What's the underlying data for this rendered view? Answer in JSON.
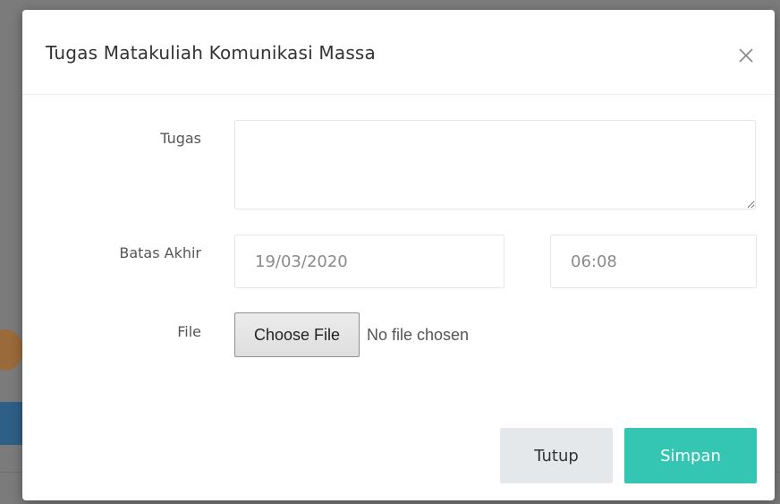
{
  "modal": {
    "title": "Tugas Matakuliah Komunikasi Massa",
    "close_icon": "close-icon",
    "fields": {
      "tugas": {
        "label": "Tugas",
        "value": ""
      },
      "batas_akhir": {
        "label": "Batas Akhir",
        "date": "19/03/2020",
        "time": "06:08"
      },
      "file": {
        "label": "File",
        "button_label": "Choose File",
        "status": "No file chosen"
      }
    },
    "buttons": {
      "close_label": "Tutup",
      "save_label": "Simpan"
    }
  },
  "colors": {
    "overlay": "#7b7b7b",
    "save_button": "#34c6b3",
    "close_button": "#e5e8eb"
  }
}
